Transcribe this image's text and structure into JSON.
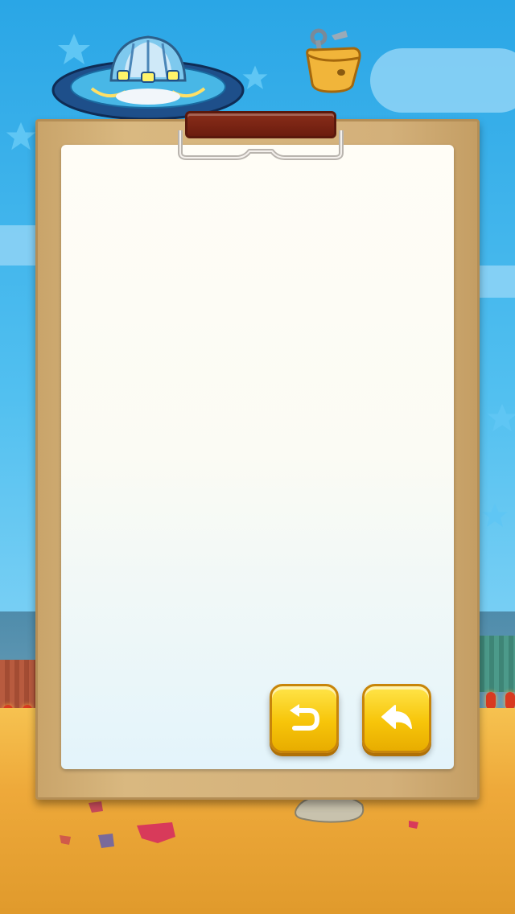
{
  "scene": {
    "colors": {
      "sky_top": "#2aa6e6",
      "ground": "#f0b23c",
      "board": "#d3b07a",
      "clip": "#7a2413",
      "button": "#f7c50a"
    }
  },
  "header": {
    "ufo_icon": "ufo-icon",
    "tool_bag_icon": "tool-bag-icon"
  },
  "clipboard": {
    "content_text": ""
  },
  "controls": {
    "undo_icon": "undo-icon",
    "back_icon": "back-arrow-icon"
  }
}
